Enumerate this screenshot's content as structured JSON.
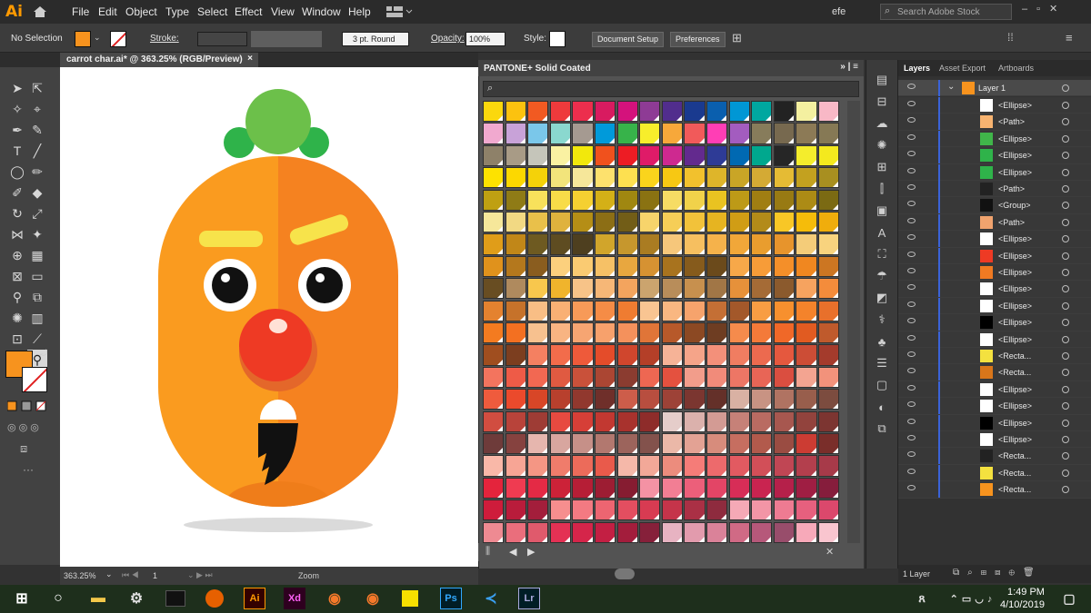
{
  "app": {
    "logo": "Ai",
    "menus": [
      "File",
      "Edit",
      "Object",
      "Type",
      "Select",
      "Effect",
      "View",
      "Window",
      "Help"
    ],
    "user": "efe",
    "search_placeholder": "Search Adobe Stock"
  },
  "control_bar": {
    "selection": "No Selection",
    "fill_color": "#f7931e",
    "stroke_label": "Stroke:",
    "brush": "3 pt. Round",
    "opacity_label": "Opacity:",
    "opacity": "100%",
    "style_label": "Style:",
    "doc_setup": "Document Setup",
    "preferences": "Preferences"
  },
  "document": {
    "tab_title": "carrot char.ai* @ 363.25% (RGB/Preview)",
    "close": "×"
  },
  "status": {
    "zoom": "363.25%",
    "page": "1",
    "mode": "Zoom"
  },
  "swatches": {
    "title": "PANTONE+ Solid Coated",
    "rows": [
      [
        "#fbd80d",
        "#fcc20f",
        "#f15a22",
        "#ee3a3c",
        "#ec2e4d",
        "#d81b60",
        "#d4127c",
        "#8e3b95",
        "#512d8d",
        "#1a3a8f",
        "#0a5fae",
        "#0097d5",
        "#00a7a0",
        "#222222",
        "#f4f0a0",
        "#f8b8c6"
      ],
      [
        "#f1a9cf",
        "#c8a2d8",
        "#7ac7ea",
        "#8ad8cf",
        "#a59a91",
        "#009ada",
        "#37b34a",
        "#f7ee2b",
        "#f7a83a",
        "#f15a5a",
        "#ff3eb5",
        "#a35cbf",
        "#877c5b",
        "#77694f",
        "#8c7a56",
        "#867955"
      ],
      [
        "#8e8169",
        "#a89b86",
        "#c5c5ba",
        "#faf1a2",
        "#f2e80c",
        "#f0511d",
        "#ed1c24",
        "#df1b68",
        "#ce2990",
        "#632a8e",
        "#2e3b96",
        "#0069b2",
        "#00a88e",
        "#262626",
        "#f4ed2c",
        "#f4e91e"
      ],
      [
        "#fde200",
        "#fcd800",
        "#f4d209",
        "#f2e47b",
        "#f6e79a",
        "#fde16d",
        "#fde050",
        "#fad41c",
        "#f7c813",
        "#f2c12d",
        "#deb52a",
        "#c9a526",
        "#d4aa34",
        "#e5bb34",
        "#c3a11f",
        "#a88f20"
      ],
      [
        "#bfa012",
        "#8f7b16",
        "#f8e15b",
        "#f8dc48",
        "#f5d031",
        "#d4b017",
        "#a08710",
        "#8a7212",
        "#f6dc64",
        "#f1d24a",
        "#e9c321",
        "#bd9a17",
        "#a07e12",
        "#987a13",
        "#ac8b15",
        "#7b6a13"
      ],
      [
        "#f6e79a",
        "#f2d983",
        "#e9c04a",
        "#dfb23d",
        "#b58e16",
        "#8c6e15",
        "#725d17",
        "#f7d46b",
        "#f6ce57",
        "#f2c23a",
        "#e6b421",
        "#d09d15",
        "#b38b19",
        "#f8c726",
        "#f5bc0a",
        "#f0ad0c"
      ],
      [
        "#e09d19",
        "#c18718",
        "#6e5a21",
        "#5e4c21",
        "#4e3f1f",
        "#d1a52b",
        "#c6972d",
        "#aa7c22",
        "#f6c77b",
        "#f6bf60",
        "#f5b24b",
        "#f1a739",
        "#e99d2e",
        "#e7942c",
        "#f4cc79",
        "#f8d37e"
      ],
      [
        "#e0921c",
        "#b4781d",
        "#8a5d1f",
        "#fcd07d",
        "#facb72",
        "#f6c166",
        "#e8a73f",
        "#d69232",
        "#a8731e",
        "#865b1c",
        "#6b4a1b",
        "#f7a849",
        "#f79c38",
        "#f48f29",
        "#f08720",
        "#cc7622"
      ],
      [
        "#684d22",
        "#af8a5e",
        "#f8c74d",
        "#f0b42c",
        "#f7c388",
        "#f6b777",
        "#f3a45e",
        "#cba46e",
        "#b88d5a",
        "#c7904e",
        "#a17646",
        "#e6913a",
        "#a56b36",
        "#8b5a2d",
        "#f6a35f",
        "#f48c3b"
      ],
      [
        "#e4822f",
        "#c6722a",
        "#f9be85",
        "#f9b074",
        "#f79a58",
        "#f58c46",
        "#ef7c31",
        "#f9c592",
        "#f9b781",
        "#f6a36c",
        "#c46f35",
        "#a3582a",
        "#f89d43",
        "#f7902e",
        "#f4832b",
        "#e8702b"
      ],
      [
        "#f47b20",
        "#f37021",
        "#f7c18f",
        "#f8b482",
        "#f6a572",
        "#f7a16c",
        "#f4915c",
        "#e07538",
        "#b7592a",
        "#8c4923",
        "#6e3d22",
        "#f58b4c",
        "#f47a39",
        "#f06828",
        "#e15b21",
        "#bf5a2c"
      ],
      [
        "#a04e1f",
        "#7c3e1f",
        "#f48061",
        "#f26c4b",
        "#ee5a3a",
        "#e44c2a",
        "#d0462d",
        "#b43f28",
        "#f6b397",
        "#f5a489",
        "#f3907a",
        "#f07d61",
        "#ec6a4f",
        "#e5583e",
        "#cc4d36",
        "#a43b2c"
      ],
      [
        "#f3745e",
        "#ee5b47",
        "#f26852",
        "#e05a41",
        "#c9513a",
        "#ab4633",
        "#8b3c30",
        "#ee6752",
        "#e4513f",
        "#f29d8b",
        "#f18b7a",
        "#ed7665",
        "#e86556",
        "#da4e40",
        "#f3a491",
        "#f2927b"
      ],
      [
        "#ef5b3d",
        "#eb4a2c",
        "#d84627",
        "#b8402d",
        "#91382e",
        "#6f2f2a",
        "#cd5d4a",
        "#b84e3f",
        "#9d4237",
        "#7b3630",
        "#643029",
        "#d9b1a3",
        "#c89383",
        "#b07362",
        "#985e4c",
        "#7c4c3f"
      ],
      [
        "#d14d40",
        "#b8433a",
        "#9e3c35",
        "#e74a40",
        "#d63f37",
        "#c23831",
        "#a8322d",
        "#8e2c2a",
        "#e5cdca",
        "#dbb1ac",
        "#d39b94",
        "#c68178",
        "#b96b62",
        "#a7574f",
        "#92433d",
        "#7c3531"
      ],
      [
        "#6e3b3a",
        "#86423f",
        "#e6b6ae",
        "#d8a69f",
        "#c69088",
        "#b2786f",
        "#9c645c",
        "#83524c",
        "#ebb8a8",
        "#e3a294",
        "#d78c7c",
        "#c66e60",
        "#b25a4c",
        "#9a4c42",
        "#cc3c33",
        "#7a2e2a"
      ],
      [
        "#f9b8a8",
        "#f7a595",
        "#f49684",
        "#f07c6b",
        "#ec6b5a",
        "#e95a4b",
        "#f5b8a9",
        "#f2a898",
        "#ec8c7d",
        "#f57c78",
        "#ed6a6c",
        "#e25a61",
        "#d24f58",
        "#c04654",
        "#b33f4d",
        "#a73a49"
      ],
      [
        "#e4243c",
        "#ef3b51",
        "#e42a45",
        "#cc2238",
        "#b61e36",
        "#9d1d33",
        "#861c31",
        "#f492a4",
        "#f27e94",
        "#ec5f7a",
        "#e34566",
        "#d72d57",
        "#c92450",
        "#b5204a",
        "#9f1e43",
        "#861d3c"
      ],
      [
        "#ce1c3b",
        "#b91c3b",
        "#a31e3b",
        "#f68e8e",
        "#f37a82",
        "#ed6571",
        "#e34e60",
        "#d83b52",
        "#c5344a",
        "#aa3045",
        "#8e2b3e",
        "#f5a9b6",
        "#f395a6",
        "#ee7b92",
        "#e6607e",
        "#db486c"
      ],
      [
        "#ee8a92",
        "#ea6e7c",
        "#e05a6c",
        "#e43154",
        "#d5254a",
        "#c31f43",
        "#a31d3c",
        "#86203a",
        "#e7b3c2",
        "#e29bad",
        "#da8299",
        "#d06a85",
        "#b6587a",
        "#984d6b",
        "#f7a9b9",
        "#f9c5cf"
      ]
    ]
  },
  "layers": {
    "tabs": [
      "Layers",
      "Asset Export",
      "Artboards"
    ],
    "layer_name": "Layer 1",
    "items": [
      {
        "name": "<Ellipse>",
        "thumb": "#ffffff"
      },
      {
        "name": "<Path>",
        "thumb": "#f7b370"
      },
      {
        "name": "<Ellipse>",
        "thumb": "#40b64a"
      },
      {
        "name": "<Ellipse>",
        "thumb": "#2fb34a"
      },
      {
        "name": "<Ellipse>",
        "thumb": "#2fb34a"
      },
      {
        "name": "<Path>",
        "thumb": "#222222"
      },
      {
        "name": "<Group>",
        "thumb": "#111111"
      },
      {
        "name": "<Path>",
        "thumb": "#f0a36e"
      },
      {
        "name": "<Ellipse>",
        "thumb": "#ffffff"
      },
      {
        "name": "<Ellipse>",
        "thumb": "#ee3a24"
      },
      {
        "name": "<Ellipse>",
        "thumb": "#f07a22"
      },
      {
        "name": "<Ellipse>",
        "thumb": "#ffffff"
      },
      {
        "name": "<Ellipse>",
        "thumb": "#ffffff"
      },
      {
        "name": "<Ellipse>",
        "thumb": "#000000"
      },
      {
        "name": "<Ellipse>",
        "thumb": "#ffffff"
      },
      {
        "name": "<Recta...",
        "thumb": "#f4e13f"
      },
      {
        "name": "<Recta...",
        "thumb": "#d9761a"
      },
      {
        "name": "<Ellipse>",
        "thumb": "#ffffff"
      },
      {
        "name": "<Ellipse>",
        "thumb": "#ffffff"
      },
      {
        "name": "<Ellipse>",
        "thumb": "#000000"
      },
      {
        "name": "<Ellipse>",
        "thumb": "#ffffff"
      },
      {
        "name": "<Recta...",
        "thumb": "#222222"
      },
      {
        "name": "<Recta...",
        "thumb": "#f4e13f"
      },
      {
        "name": "<Recta...",
        "thumb": "#f7931e"
      }
    ],
    "footer": "1 Layer"
  },
  "taskbar": {
    "time": "1:49 PM",
    "date": "4/10/2019",
    "apps": [
      "Ai",
      "Xd",
      "Ps",
      "Lr"
    ]
  }
}
